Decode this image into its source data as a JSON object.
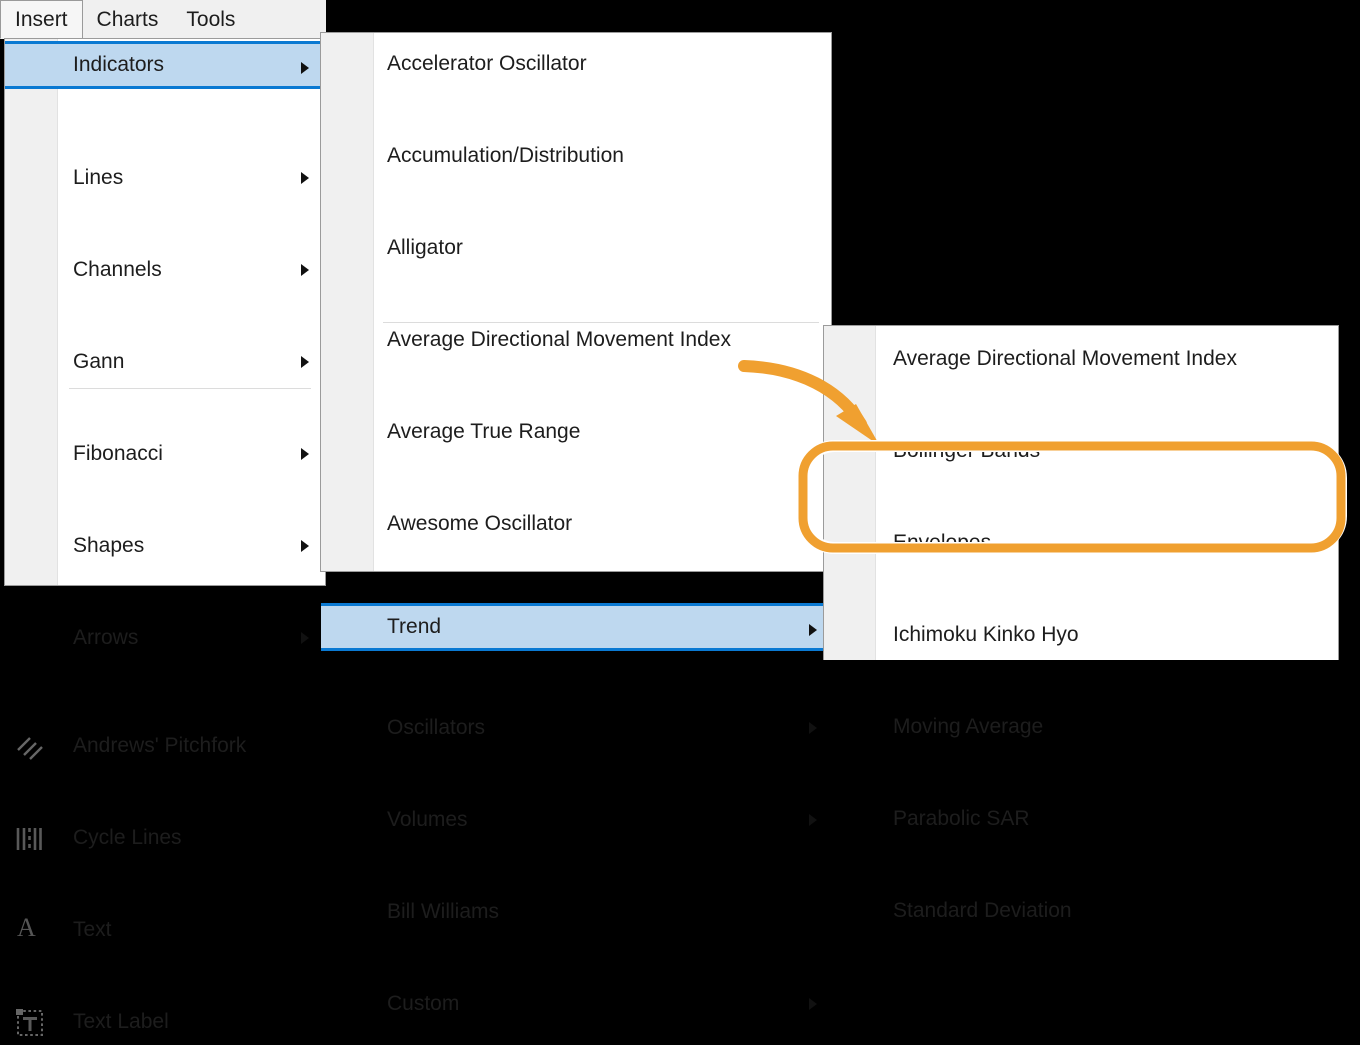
{
  "window": {
    "background_color": "#000000",
    "menubar_background": "#f0f0f0",
    "highlight_fill": "#bed8ef",
    "highlight_border": "#0a79d2",
    "annotation_color": "#f0a030"
  },
  "menubar": {
    "tabs": [
      {
        "label": "Insert",
        "active": true
      },
      {
        "label": "Charts",
        "active": false
      },
      {
        "label": "Tools",
        "active": false
      }
    ]
  },
  "insert_menu": {
    "items": [
      {
        "label": "Indicators",
        "submenu": true,
        "highlighted": true,
        "icon": null
      },
      {
        "label": "Lines",
        "submenu": true,
        "highlighted": false,
        "icon": null
      },
      {
        "label": "Channels",
        "submenu": true,
        "highlighted": false,
        "icon": null
      },
      {
        "label": "Gann",
        "submenu": true,
        "highlighted": false,
        "icon": null
      },
      {
        "label": "Fibonacci",
        "submenu": true,
        "highlighted": false,
        "icon": null
      },
      {
        "label": "Shapes",
        "submenu": true,
        "highlighted": false,
        "icon": null
      },
      {
        "label": "Arrows",
        "submenu": true,
        "highlighted": false,
        "icon": null
      },
      {
        "label": "Andrews' Pitchfork",
        "submenu": false,
        "highlighted": false,
        "icon": "pitchfork-icon"
      },
      {
        "label": "Cycle Lines",
        "submenu": false,
        "highlighted": false,
        "icon": "cycle-lines-icon"
      },
      {
        "label": "Text",
        "submenu": false,
        "highlighted": false,
        "icon": "text-icon"
      },
      {
        "label": "Text Label",
        "submenu": false,
        "highlighted": false,
        "icon": "text-label-icon"
      }
    ]
  },
  "indicators_menu": {
    "items": [
      {
        "label": "Accelerator Oscillator",
        "submenu": false,
        "highlighted": false
      },
      {
        "label": "Accumulation/Distribution",
        "submenu": false,
        "highlighted": false
      },
      {
        "label": "Alligator",
        "submenu": false,
        "highlighted": false
      },
      {
        "label": "Average Directional Movement Index",
        "submenu": false,
        "highlighted": false
      },
      {
        "label": "Average True Range",
        "submenu": false,
        "highlighted": false
      },
      {
        "label": "Awesome Oscillator",
        "submenu": false,
        "highlighted": false
      },
      {
        "label": "Trend",
        "submenu": true,
        "highlighted": true
      },
      {
        "label": "Oscillators",
        "submenu": true,
        "highlighted": false
      },
      {
        "label": "Volumes",
        "submenu": true,
        "highlighted": false
      },
      {
        "label": "Bill Williams",
        "submenu": false,
        "highlighted": false
      },
      {
        "label": "Custom",
        "submenu": true,
        "highlighted": false
      }
    ]
  },
  "trend_menu": {
    "items": [
      {
        "label": "Average Directional Movement Index",
        "highlighted": false,
        "occluded": "none"
      },
      {
        "label": "Bollinger Bands",
        "highlighted": false,
        "occluded": "none"
      },
      {
        "label": "Envelopes",
        "highlighted": false,
        "occluded": "bottom"
      },
      {
        "label": "Ichimoku Kinko Hyo",
        "highlighted": true,
        "occluded": "none"
      },
      {
        "label": "Moving Average",
        "highlighted": false,
        "occluded": "top"
      },
      {
        "label": "Parabolic SAR",
        "highlighted": false,
        "occluded": "none"
      },
      {
        "label": "Standard Deviation",
        "highlighted": false,
        "occluded": "none"
      }
    ]
  },
  "annotations": {
    "callout_target": "Ichimoku Kinko Hyo",
    "arrow": "curved-arrow-to-ichimoku",
    "highlight_box": "rounded-rect-around-ichimoku"
  }
}
